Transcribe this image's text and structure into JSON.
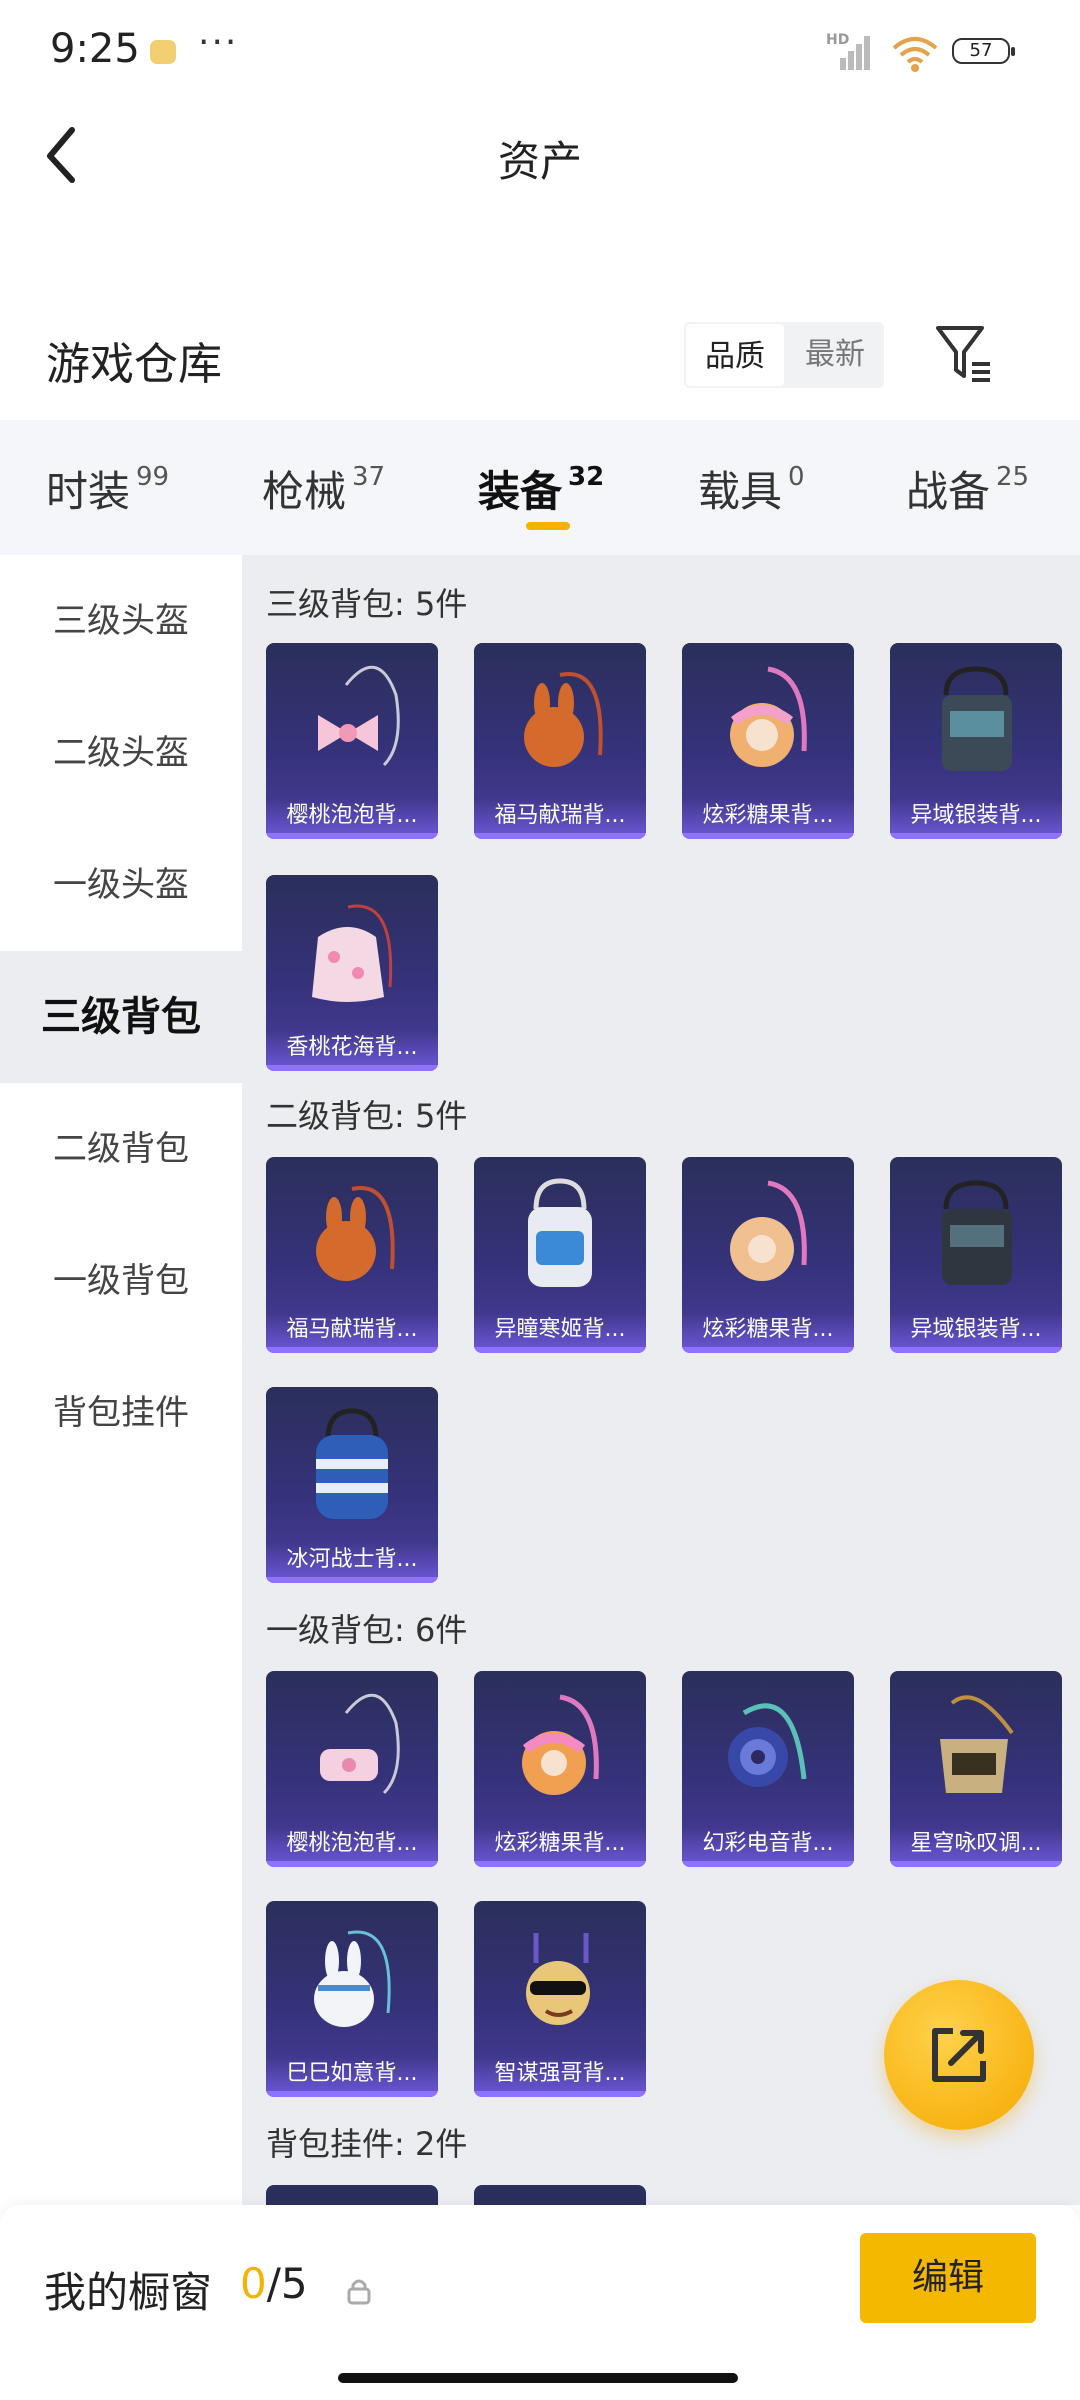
{
  "status_bar": {
    "time": "9:25",
    "dots": "···",
    "battery": "57",
    "network": "HD"
  },
  "header": {
    "title": "资产"
  },
  "warehouse": {
    "title": "游戏仓库",
    "sort_options": [
      "品质",
      "最新"
    ],
    "sort_selected": "品质"
  },
  "tabs": [
    {
      "label": "时装",
      "count": "99"
    },
    {
      "label": "枪械",
      "count": "37"
    },
    {
      "label": "装备",
      "count": "32",
      "active": true
    },
    {
      "label": "载具",
      "count": "0"
    },
    {
      "label": "战备",
      "count": "25"
    }
  ],
  "sidebar": {
    "items": [
      "三级头盔",
      "二级头盔",
      "一级头盔",
      "三级背包",
      "二级背包",
      "一级背包",
      "背包挂件"
    ],
    "active": "三级背包"
  },
  "sections": [
    {
      "title": "三级背包: 5件",
      "items": [
        "樱桃泡泡背...",
        "福马献瑞背...",
        "炫彩糖果背...",
        "异域银装背...",
        "香桃花海背..."
      ]
    },
    {
      "title": "二级背包: 5件",
      "items": [
        "福马献瑞背...",
        "异瞳寒姬背...",
        "炫彩糖果背...",
        "异域银装背...",
        "冰河战士背..."
      ]
    },
    {
      "title": "一级背包: 6件",
      "items": [
        "樱桃泡泡背...",
        "炫彩糖果背...",
        "幻彩电音背...",
        "星穹咏叹调...",
        "巳巳如意背...",
        "智谋强哥背..."
      ]
    },
    {
      "title": "背包挂件: 2件",
      "items": []
    }
  ],
  "bottom_bar": {
    "window_title": "我的橱窗",
    "window_current": "0",
    "window_total": "/5",
    "edit_label": "编辑"
  },
  "colors": {
    "accent": "#f5b300",
    "card_bg": "#35327a",
    "card_bar": "#8e72ff",
    "content_bg": "#ebedf1"
  }
}
